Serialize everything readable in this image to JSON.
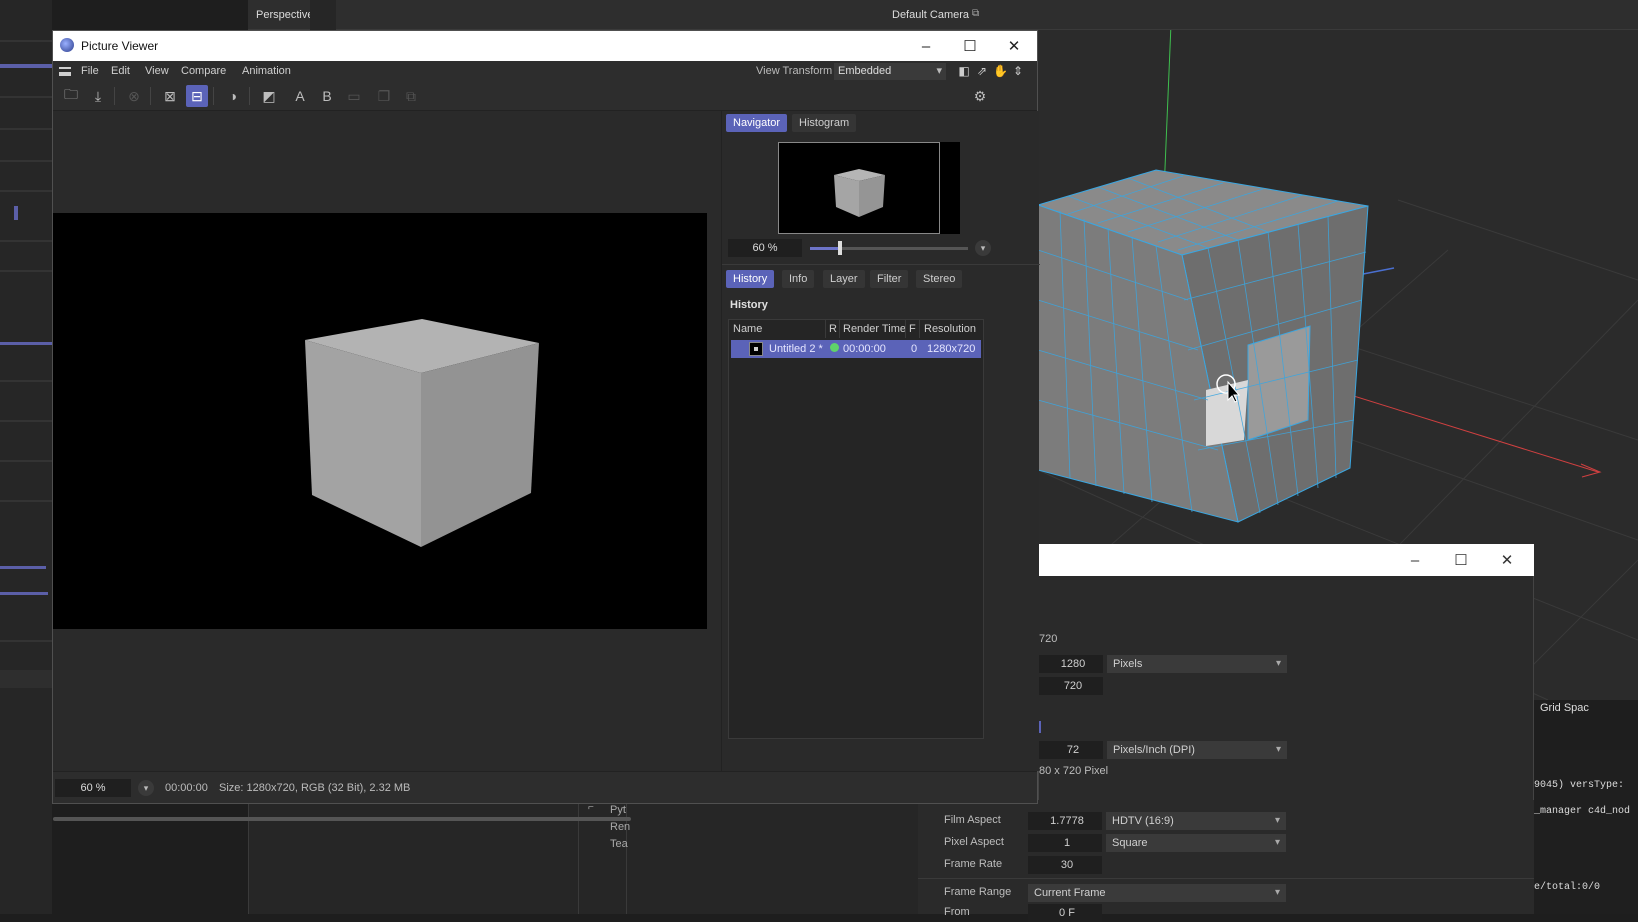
{
  "viewport": {
    "name": "Perspective",
    "camera": "Default Camera",
    "camera_icon": "camera-lock-icon",
    "grid_label": "Grid Spac"
  },
  "render_settings": {
    "width_fragment": "720",
    "width": "1280",
    "width_unit": "Pixels",
    "height": "720",
    "resolution": "72",
    "resolution_unit": "Pixels/Inch (DPI)",
    "image_size_fragment": "80 x 720 Pixel",
    "film_aspect_label": "Film Aspect",
    "film_aspect": "1.7778",
    "film_aspect_preset": "HDTV (16:9)",
    "pixel_aspect_label": "Pixel Aspect",
    "pixel_aspect": "1",
    "pixel_aspect_preset": "Square",
    "frame_rate_label": "Frame Rate",
    "frame_rate": "30",
    "frame_range_label": "Frame Range",
    "frame_range": "Current Frame",
    "from_label": "From",
    "from_value": "0 F"
  },
  "bottom_panel": {
    "items": [
      "Pyt",
      "Ren",
      "Tea"
    ]
  },
  "console": {
    "lines": [
      "9045)  versType:",
      "_manager c4d_nod",
      "e/total:0/0"
    ]
  },
  "picture_viewer": {
    "title": "Picture Viewer",
    "menu": [
      "File",
      "Edit",
      "View",
      "Compare",
      "Animation"
    ],
    "view_transform_label": "View Transform",
    "view_transform_value": "Embedded",
    "toolbar_text_a": "A",
    "toolbar_text_b": "B",
    "right_tabs_top": [
      "Navigator",
      "Histogram"
    ],
    "zoom": "60 %",
    "right_tabs_bottom": [
      "History",
      "Info",
      "Layer",
      "Filter",
      "Stereo"
    ],
    "history_heading": "History",
    "history_columns": [
      "Name",
      "R",
      "Render Time",
      "F",
      "Resolution"
    ],
    "history_rows": [
      {
        "name": "Untitled 2 *",
        "render_time": "00:00:00",
        "frame": "0",
        "resolution": "1280x720"
      }
    ],
    "status_zoom": "60 %",
    "status_time": "00:00:00",
    "status_info": "Size: 1280x720, RGB (32 Bit), 2.32 MB"
  },
  "colors": {
    "accent": "#5b63b8",
    "window_bg": "#2a2a2a",
    "render_ok": "#5fd36a"
  }
}
